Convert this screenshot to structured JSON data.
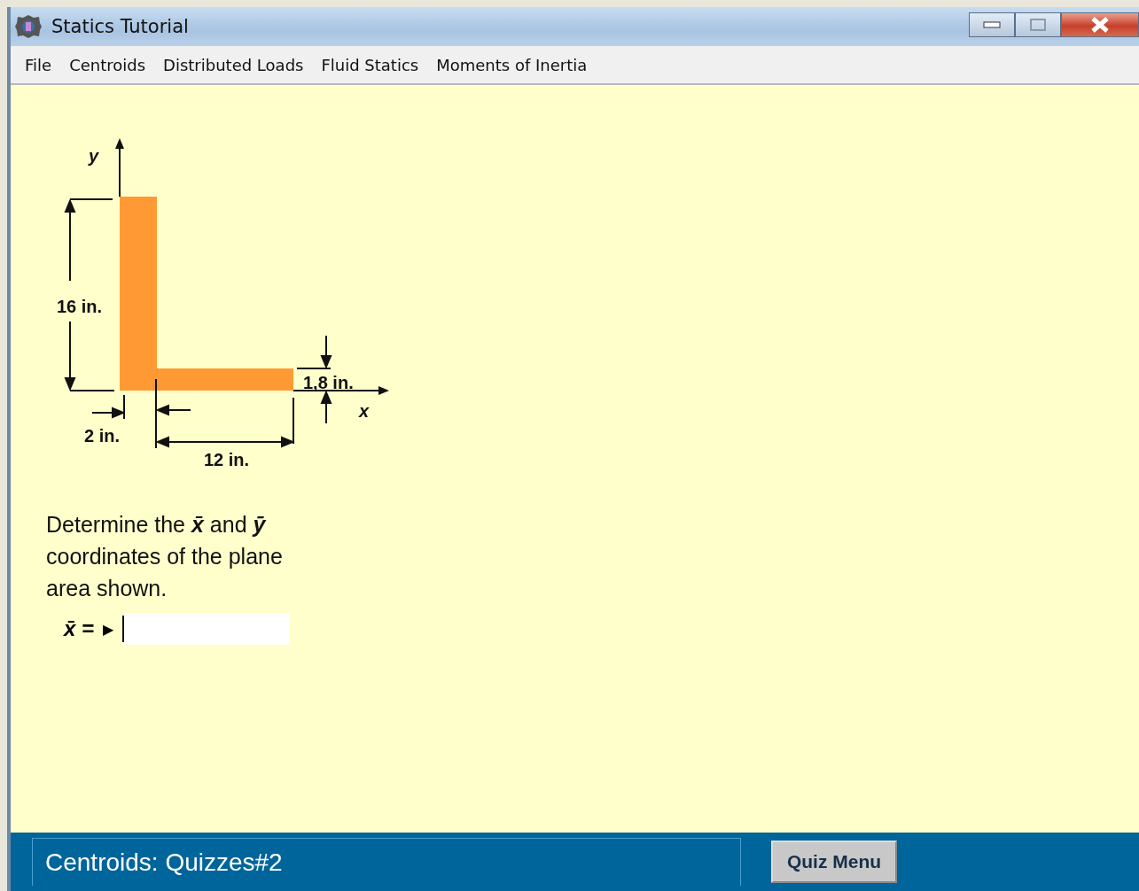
{
  "window": {
    "title": "Statics Tutorial"
  },
  "menu": [
    {
      "label": "File"
    },
    {
      "label": "Centroids"
    },
    {
      "label": "Distributed Loads"
    },
    {
      "label": "Fluid Statics"
    },
    {
      "label": "Moments of Inertia"
    }
  ],
  "figure": {
    "y_axis": "y",
    "x_axis": "x",
    "height": "16 in.",
    "vertical_thickness": "2 in.",
    "length": "12 in.",
    "horizontal_thickness": "1,8 in."
  },
  "question": "Determine the **x̄** and **ȳ** coordinates of the plane area shown.",
  "answer": {
    "label": "x̄ =",
    "marker": "▶"
  },
  "status_bar": {
    "text": "Centroids: Quizzes#2",
    "button": "Quiz Menu"
  }
}
